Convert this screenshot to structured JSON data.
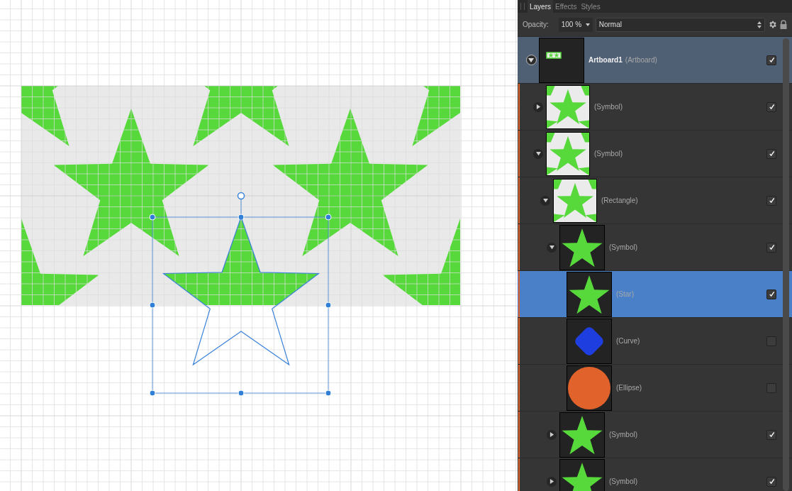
{
  "panel": {
    "tabs": [
      {
        "label": "Layers",
        "selected": true
      },
      {
        "label": "Effects",
        "selected": false
      },
      {
        "label": "Styles",
        "selected": false
      }
    ],
    "opacity": {
      "label": "Opacity:",
      "value": "100 %"
    },
    "blend_mode": {
      "value": "Normal"
    },
    "layers": [
      {
        "name": "Artboard1",
        "type": "(Artboard)",
        "kind": "artboard",
        "expanded": true,
        "visible": true,
        "selected": false,
        "children": [
          {
            "type": "(Symbol)",
            "kind": "pattern",
            "expanded": false,
            "visible": true,
            "selected": false
          },
          {
            "type": "(Symbol)",
            "kind": "pattern",
            "expanded": true,
            "visible": true,
            "selected": false,
            "children": [
              {
                "type": "(Rectangle)",
                "kind": "pattern",
                "expanded": true,
                "visible": true,
                "selected": false,
                "children": [
                  {
                    "type": "(Symbol)",
                    "kind": "star",
                    "expanded": true,
                    "visible": true,
                    "selected": false,
                    "children": [
                      {
                        "type": "(Star)",
                        "kind": "star",
                        "visible": true,
                        "selected": true
                      },
                      {
                        "type": "(Curve)",
                        "kind": "curve",
                        "visible": false,
                        "selected": false
                      },
                      {
                        "type": "(Ellipse)",
                        "kind": "ellipse",
                        "visible": false,
                        "selected": false
                      }
                    ]
                  },
                  {
                    "type": "(Symbol)",
                    "kind": "star",
                    "expanded": false,
                    "visible": true,
                    "selected": false
                  },
                  {
                    "type": "(Symbol)",
                    "kind": "star",
                    "expanded": false,
                    "visible": true,
                    "selected": false
                  }
                ]
              }
            ]
          }
        ]
      }
    ]
  }
}
